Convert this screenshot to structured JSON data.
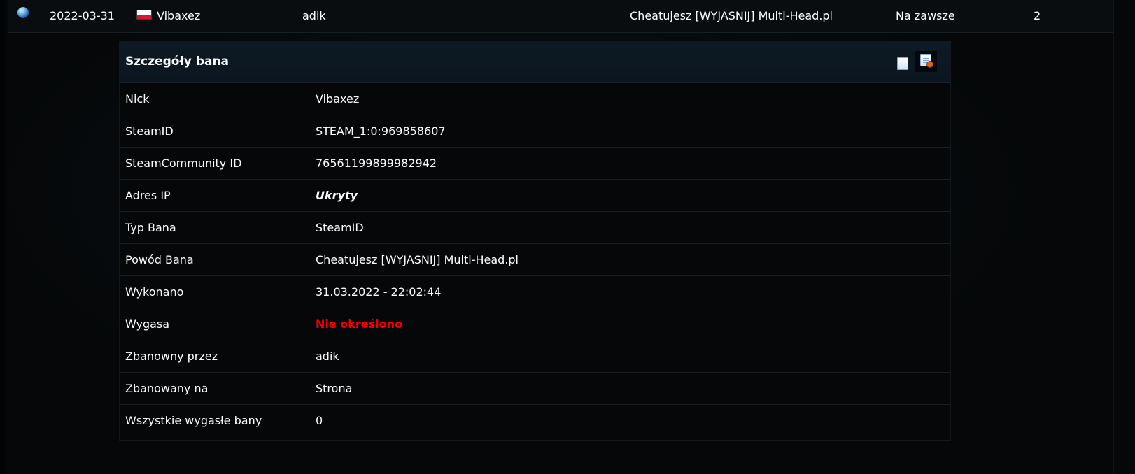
{
  "ban_list_row": {
    "date": "2022-03-31",
    "player": "Vibaxez",
    "admin": "adik",
    "reason": "Cheatujesz [WYJASNIJ] Multi-Head.pl",
    "length": "Na zawsze",
    "count": "2",
    "icons": [
      "globe-icon",
      "poland-flag-icon"
    ]
  },
  "details": {
    "title": "Szczegóły bana",
    "header_icons": [
      "document-icon",
      "edit-document-icon"
    ],
    "rows": [
      {
        "label": "Nick",
        "value": "Vibaxez"
      },
      {
        "label": "SteamID",
        "value": "STEAM_1:0:969858607"
      },
      {
        "label": "SteamCommunity ID",
        "value": "76561199899982942"
      },
      {
        "label": "Adres IP",
        "value": "Ukryty"
      },
      {
        "label": "Typ Bana",
        "value": "SteamID"
      },
      {
        "label": "Powód Bana",
        "value": "Cheatujesz [WYJASNIJ] Multi-Head.pl"
      },
      {
        "label": "Wykonano",
        "value": "31.03.2022 - 22:02:44"
      },
      {
        "label": "Wygasa",
        "value": "Nie określono"
      },
      {
        "label": "Zbanowny przez",
        "value": "adik"
      },
      {
        "label": "Zbanowany na",
        "value": "Strona"
      },
      {
        "label": "Wszystkie wygasłe bany",
        "value": "0"
      }
    ]
  },
  "colors": {
    "background": "#050708",
    "header": "#0d1a24",
    "row_divider": "#1a1f24",
    "text": "#ffffff",
    "expired_red": "#ee0000"
  }
}
